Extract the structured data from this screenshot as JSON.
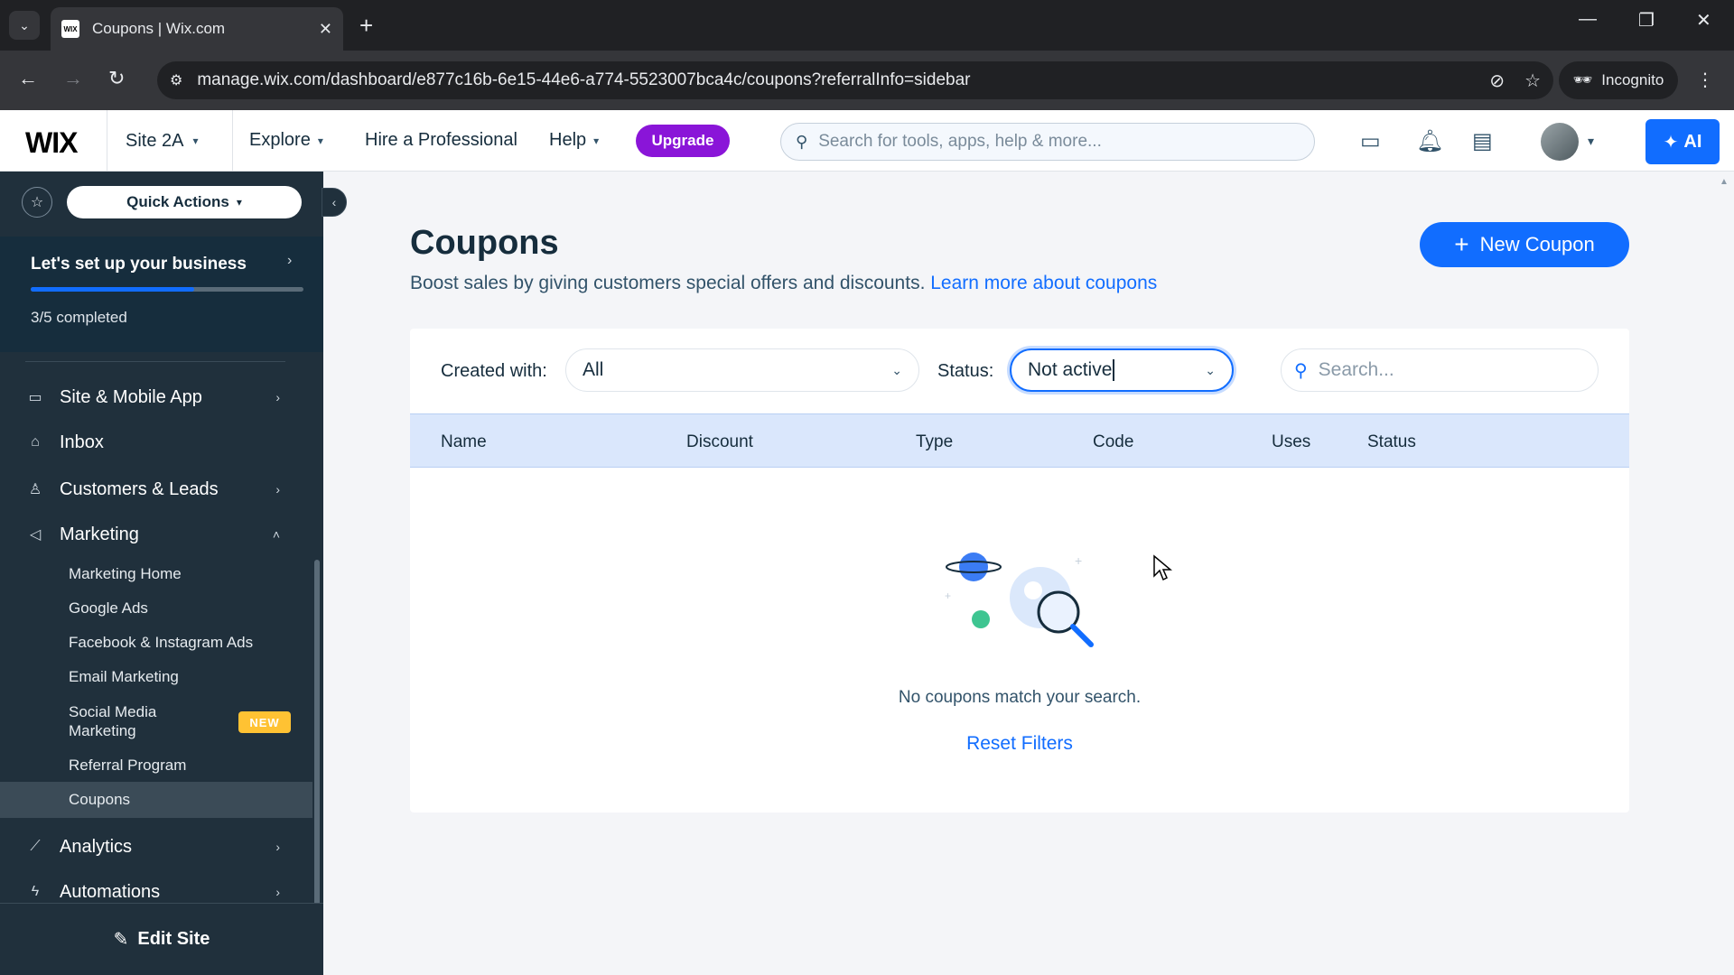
{
  "browser": {
    "tab_title": "Coupons | Wix.com",
    "favicon_text": "WIX",
    "url": "manage.wix.com/dashboard/e877c16b-6e15-44e6-a774-5523007bca4c/coupons?referralInfo=sidebar",
    "incognito_label": "Incognito"
  },
  "topbar": {
    "logo": "WIX",
    "site_name": "Site 2A",
    "explore": "Explore",
    "hire": "Hire a Professional",
    "help": "Help",
    "upgrade": "Upgrade",
    "search_placeholder": "Search for tools, apps, help & more...",
    "ai_label": "AI"
  },
  "sidebar": {
    "quick_actions": "Quick Actions",
    "setup_title": "Let's set up your business",
    "setup_progress": 0.6,
    "setup_count": "3/5 completed",
    "items": [
      {
        "label": "Site & Mobile App",
        "icon": "monitor-icon"
      },
      {
        "label": "Inbox",
        "icon": "inbox-icon"
      },
      {
        "label": "Customers & Leads",
        "icon": "people-icon"
      },
      {
        "label": "Marketing",
        "icon": "megaphone-icon"
      },
      {
        "label": "Analytics",
        "icon": "chart-icon"
      },
      {
        "label": "Automations",
        "icon": "bolt-icon"
      }
    ],
    "marketing_sub": [
      "Marketing Home",
      "Google Ads",
      "Facebook & Instagram Ads",
      "Email Marketing",
      "Social Media Marketing",
      "Referral Program",
      "Coupons"
    ],
    "new_badge": "NEW",
    "edit_site": "Edit Site"
  },
  "main": {
    "title": "Coupons",
    "subtitle": "Boost sales by giving customers special offers and discounts.",
    "learn_more": "Learn more about coupons",
    "new_coupon": "New Coupon",
    "filters": {
      "created_with_label": "Created with:",
      "created_with_value": "All",
      "status_label": "Status:",
      "status_value": "Not active",
      "search_placeholder": "Search..."
    },
    "columns": [
      "Name",
      "Discount",
      "Type",
      "Code",
      "Uses",
      "Status"
    ],
    "empty_text": "No coupons match your search.",
    "reset_filters": "Reset Filters"
  },
  "colors": {
    "accent": "#116dff",
    "upgrade": "#8a15d8",
    "sidebar_bg": "#20303c",
    "badge": "#ffc233"
  }
}
